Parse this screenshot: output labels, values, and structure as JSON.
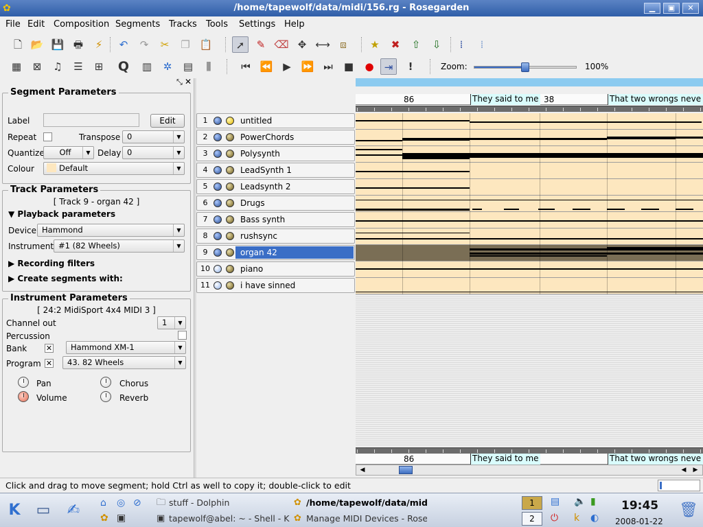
{
  "window": {
    "title": "/home/tapewolf/data/midi/156.rg - Rosegarden",
    "min": "▁",
    "max": "▣",
    "close": "✕"
  },
  "menu": [
    "File",
    "Edit",
    "Composition",
    "Segments",
    "Tracks",
    "Tools",
    "Settings",
    "Help"
  ],
  "zoom": {
    "label": "Zoom:",
    "value": "100%",
    "fraction": 0.5
  },
  "segment_params": {
    "title": "Segment Parameters",
    "label_label": "Label",
    "label_value": "",
    "edit": "Edit",
    "repeat_label": "Repeat",
    "transpose_label": "Transpose",
    "transpose_value": "0",
    "quantize_label": "Quantize",
    "quantize_value": "Off",
    "delay_label": "Delay",
    "delay_value": "0",
    "colour_label": "Colour",
    "colour_value": "Default"
  },
  "track_params": {
    "title": "Track Parameters",
    "track_name": "[ Track 9 - organ 42 ]",
    "playback": "Playback parameters",
    "device_label": "Device",
    "device_value": "Hammond",
    "instrument_label": "Instrument",
    "instrument_value": "#1 (82 Wheels)",
    "recording": "Recording filters",
    "create": "Create segments with:"
  },
  "instrument_params": {
    "title": "Instrument Parameters",
    "device": "[ 24:2 MidiSport 4x4 MIDI 3 ]",
    "channel_label": "Channel out",
    "channel_value": "1",
    "percussion_label": "Percussion",
    "bank_label": "Bank",
    "bank_value": "Hammond XM-1",
    "bank_check": "✕",
    "program_label": "Program",
    "program_value": "43. 82 Wheels",
    "program_check": "✕",
    "pan": "Pan",
    "chorus": "Chorus",
    "volume": "Volume",
    "reverb": "Reverb"
  },
  "tracks": [
    {
      "num": "1",
      "name": "untitled"
    },
    {
      "num": "2",
      "name": "PowerChords"
    },
    {
      "num": "3",
      "name": "Polysynth"
    },
    {
      "num": "4",
      "name": "LeadSynth 1"
    },
    {
      "num": "5",
      "name": "Leadsynth 2"
    },
    {
      "num": "6",
      "name": "Drugs"
    },
    {
      "num": "7",
      "name": "Bass synth"
    },
    {
      "num": "8",
      "name": "rushsync"
    },
    {
      "num": "9",
      "name": "organ 42"
    },
    {
      "num": "10",
      "name": "piano"
    },
    {
      "num": "11",
      "name": "i have sinned"
    }
  ],
  "ruler": {
    "bar1": "86",
    "bar2": "38",
    "marker1": "They said to me",
    "marker2": "That two wrongs neve"
  },
  "status": "Click and drag to move segment; hold Ctrl as well to copy it; double-click to edit",
  "taskbar": {
    "tasks": [
      "stuff - Dolphin",
      "/home/tapewolf/data/mid",
      "tapewolf@abel: ~ - Shell - K",
      "Manage MIDI Devices - Rose"
    ],
    "desktop_1": "1",
    "desktop_2": "2",
    "time": "19:45",
    "date": "2008-01-22"
  },
  "colors": {
    "title_bar": "#3b68b0",
    "segment": "#fde7bf",
    "selection": "#3a6ec6",
    "marker": "#d9fcfc"
  }
}
